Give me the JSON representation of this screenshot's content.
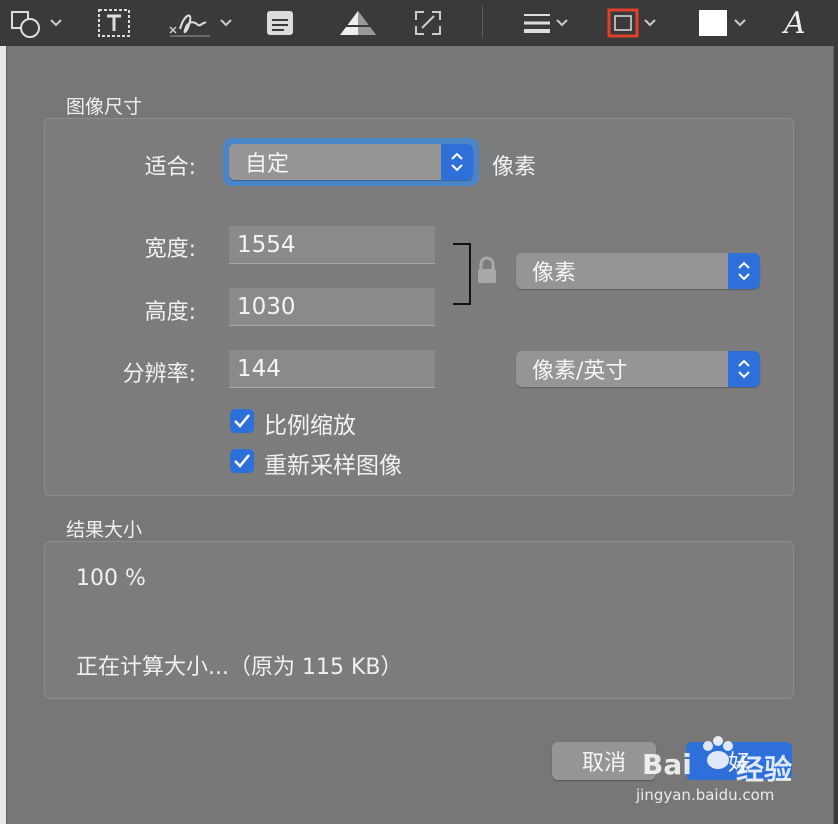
{
  "toolbar": {
    "items": [
      {
        "icon": "shapes-icon"
      },
      {
        "icon": "text-box-icon"
      },
      {
        "icon": "signature-icon"
      },
      {
        "icon": "note-icon"
      },
      {
        "icon": "adjust-color-icon"
      },
      {
        "icon": "resize-icon"
      },
      {
        "icon": "line-style-icon"
      },
      {
        "icon": "border-color-icon",
        "color": "#e0402c"
      },
      {
        "icon": "fill-color-icon",
        "color": "#ffffff"
      },
      {
        "icon": "text-style-icon",
        "glyph": "A"
      }
    ]
  },
  "image_size": {
    "title": "图像尺寸",
    "fit_label": "适合:",
    "fit_value": "自定",
    "fit_unit": "像素",
    "width_label": "宽度:",
    "width_value": "1554",
    "height_label": "高度:",
    "height_value": "1030",
    "resolution_label": "分辨率:",
    "resolution_value": "144",
    "size_unit": "像素",
    "resolution_unit": "像素/英寸",
    "scale_proportionally": {
      "label": "比例缩放",
      "checked": true
    },
    "resample_image": {
      "label": "重新采样图像",
      "checked": true
    }
  },
  "result_size": {
    "title": "结果大小",
    "percent": "100 %",
    "status": "正在计算大小...（原为 115 KB）"
  },
  "buttons": {
    "cancel": "取消",
    "ok": "好"
  },
  "watermark": {
    "brand": "Bai",
    "brand2": "经验",
    "url": "jingyan.baidu.com"
  },
  "colors": {
    "accent": "#2e6fd9",
    "sheet_bg": "#777778"
  }
}
